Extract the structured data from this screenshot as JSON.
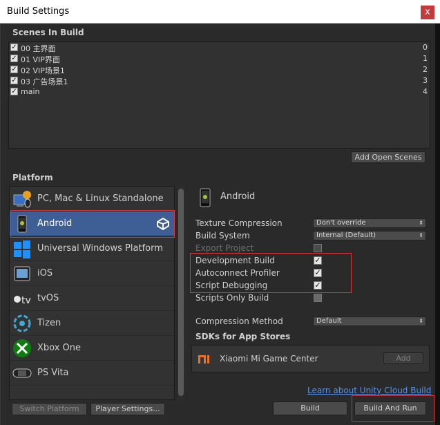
{
  "window": {
    "title": "Build Settings",
    "close": "x"
  },
  "scenes": {
    "header": "Scenes In Build",
    "items": [
      {
        "name": "00 主界面",
        "index": "0",
        "checked": true
      },
      {
        "name": "01 VIP界面",
        "index": "1",
        "checked": true
      },
      {
        "name": "02 VIP场景1",
        "index": "2",
        "checked": true
      },
      {
        "name": "03 广告场景1",
        "index": "3",
        "checked": true
      },
      {
        "name": "main",
        "index": "4",
        "checked": true
      }
    ],
    "add_open_scenes": "Add Open Scenes"
  },
  "platform": {
    "header": "Platform",
    "items": [
      {
        "label": "PC, Mac & Linux Standalone",
        "icon": "pc-standalone-icon"
      },
      {
        "label": "Android",
        "icon": "android-icon",
        "selected": true
      },
      {
        "label": "Universal Windows Platform",
        "icon": "windows-icon"
      },
      {
        "label": "iOS",
        "icon": "ios-icon"
      },
      {
        "label": "tvOS",
        "icon": "appletv-icon"
      },
      {
        "label": "Tizen",
        "icon": "tizen-icon"
      },
      {
        "label": "Xbox One",
        "icon": "xbox-icon"
      },
      {
        "label": "PS Vita",
        "icon": "psvita-icon"
      }
    ]
  },
  "android": {
    "title": "Android",
    "texture_compression_label": "Texture Compression",
    "texture_compression_value": "Don't override",
    "build_system_label": "Build System",
    "build_system_value": "Internal (Default)",
    "export_project_label": "Export Project",
    "development_build_label": "Development Build",
    "autoconnect_profiler_label": "Autoconnect Profiler",
    "script_debugging_label": "Script Debugging",
    "scripts_only_build_label": "Scripts Only Build",
    "compression_method_label": "Compression Method",
    "compression_method_value": "Default",
    "sdks_header": "SDKs for App Stores",
    "sdk_name": "Xiaomi Mi Game Center",
    "sdk_add": "Add"
  },
  "footer": {
    "cloud_link": "Learn about Unity Cloud Build",
    "switch_platform": "Switch Platform",
    "player_settings": "Player Settings...",
    "build": "Build",
    "build_and_run": "Build And Run"
  },
  "colors": {
    "background": "#2a2a2a",
    "selection": "#3e5f96",
    "highlight_box": "#dd3333",
    "link": "#5b93e0"
  }
}
